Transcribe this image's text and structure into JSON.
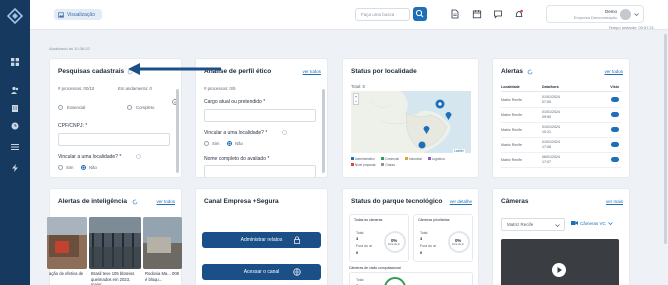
{
  "topbar": {
    "visualizacao_label": "Visualização",
    "search_placeholder": "Faça uma busca",
    "user_name": "Demo",
    "user_company": "Empresa Demonstração",
    "tempo_restante": "Tempo restante: 00:57:21"
  },
  "updated_at": "Atualizado às 10:36:32",
  "pesquisas": {
    "title": "Pesquisas cadastrais",
    "processos": "# processos: 00/10",
    "em_andamento": "Em andamento: 0",
    "option_essencial": "Essencial",
    "option_completo": "Completo",
    "cpf_label": "CPF/CNPJ: *",
    "vincular_label": "Vincular a uma localidade? *",
    "sim": "Sim",
    "nao": "Não"
  },
  "analise": {
    "title": "Análise de perfil ético",
    "link": "ver todos",
    "processos": "# processos: 0/5",
    "cargo_label": "Cargo atual ou pretendido *",
    "vincular_label": "Vincular a uma localidade? *",
    "sim": "Sim",
    "nao": "Não",
    "nome_label": "Nome completo do avaliado *"
  },
  "status_localidade": {
    "title": "Status por localidade",
    "total": "Total: 8",
    "legend": [
      "Administrativo",
      "Comercial",
      "Industrial",
      "Logística",
      "Nível proposta",
      "Outras"
    ],
    "attribution": "Leaflet"
  },
  "alertas": {
    "title": "Alertas",
    "link": "ver todos",
    "headers": [
      "Localidade",
      "Data/hora",
      "Visto"
    ],
    "rows": [
      {
        "local": "Matriz Recife",
        "data": "01/01/2024",
        "hora": "07:00"
      },
      {
        "local": "Matriz Recife",
        "data": "01/01/2024",
        "hora": "09:50"
      },
      {
        "local": "Matriz Recife",
        "data": "01/01/2024",
        "hora": "10:21"
      },
      {
        "local": "Matriz Recife",
        "data": "01/01/2024",
        "hora": "17:06"
      },
      {
        "local": "Matriz Recife",
        "data": "06/01/2024",
        "hora": "17:07"
      }
    ]
  },
  "inteligencia": {
    "title": "Alertas de inteligência",
    "link": "ver todos",
    "news": [
      {
        "text": "ação de efetiva de"
      },
      {
        "text": "Brasil teve 105 bloteios queimados em 2023, maior"
      },
      {
        "text": "Rodovia Ma... 008 é bloqu..."
      }
    ]
  },
  "canal": {
    "title": "Canal Empresa +Segura",
    "btn_admin": "Administrar relatos",
    "btn_acessar": "Acessar o canal"
  },
  "parque": {
    "title": "Status do parque tecnológico",
    "link": "ver detalhe",
    "todas_cameras": "Todas as câmeras",
    "cameras_prioritarias": "Câmeras prioritárias",
    "visao_computacional": "Câmeras de visão computacional",
    "total_label": "Total",
    "total_value": "3",
    "fora_ar_label": "Fora do ar",
    "fora_ar_value": "0",
    "pct_1": "0%",
    "pct_1_sub": "Fora do ar",
    "pct_2": "0%",
    "pct_2_sub": "Fora do ar"
  },
  "cameras": {
    "title": "Câmeras",
    "link": "ver mais",
    "select_value": "Matriz Recife",
    "tab_label": "Câmeras VC"
  },
  "colors": {
    "sidebar": "#16395f",
    "accent": "#1d6fb8",
    "arrow": "#1b4f87"
  }
}
